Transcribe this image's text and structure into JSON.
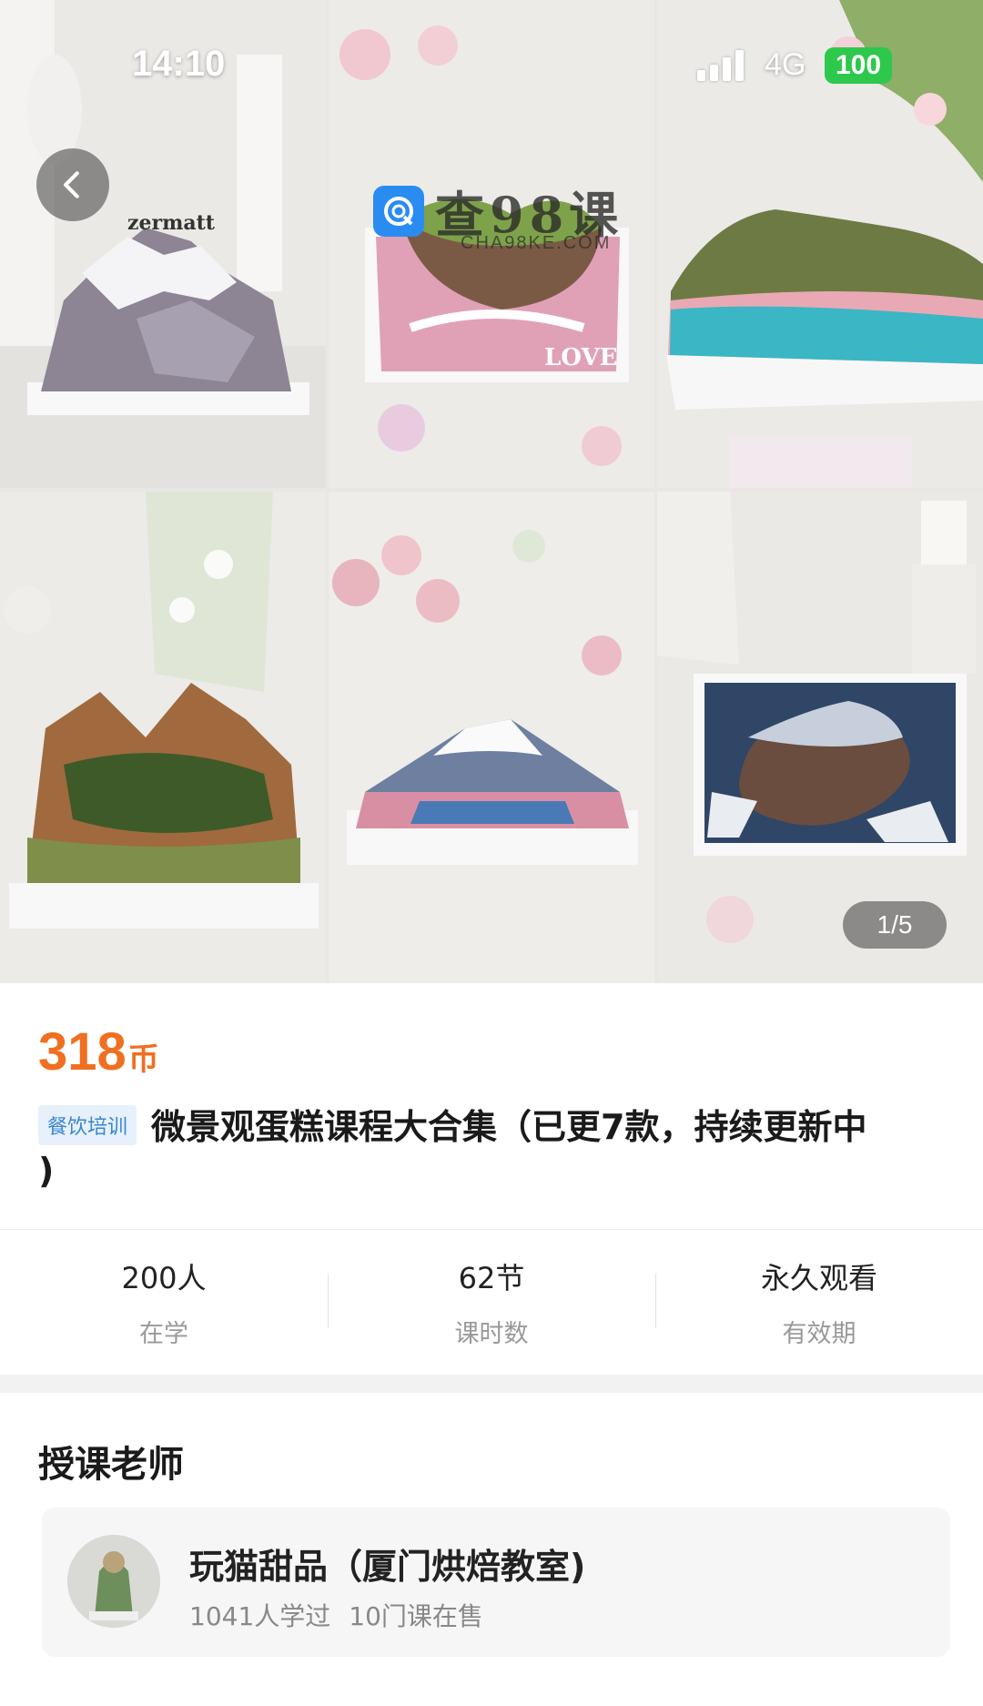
{
  "status_bar": {
    "time": "14:10",
    "network": "4G",
    "battery": "100",
    "signal_icon": "signal-bars-icon"
  },
  "hero": {
    "back_icon": "chevron-left-icon",
    "watermark_text": "查98课",
    "watermark_sub": "CHA98KE.COM",
    "cake_label_1": "zermatt",
    "cake_label_2": "LOVE",
    "pager": "1/5"
  },
  "course": {
    "price": "318",
    "price_unit": "币",
    "price_color": "#f06f21",
    "category_tag": "餐饮培训",
    "title": "微景观蛋糕课程大合集（已更7款，持续更新中",
    "title_continued": ")"
  },
  "stats": [
    {
      "value": "200人",
      "label": "在学"
    },
    {
      "value": "62节",
      "label": "课时数"
    },
    {
      "value": "永久观看",
      "label": "有效期"
    }
  ],
  "teacher": {
    "section_title": "授课老师",
    "name": "玩猫甜品（厦门烘焙教室)",
    "learners": "1041人学过",
    "courses": "10门课在售"
  }
}
